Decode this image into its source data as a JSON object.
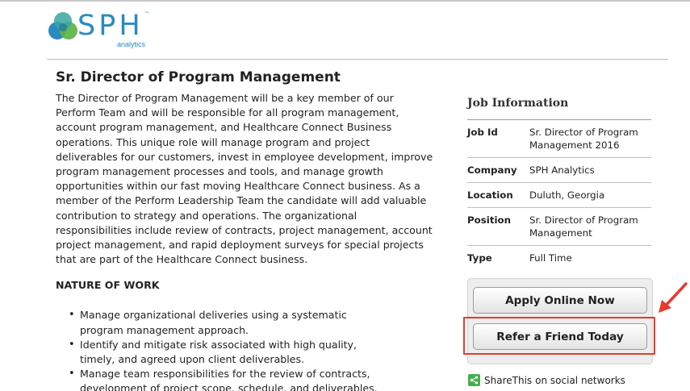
{
  "brand": {
    "name": "SPH",
    "trademark": "™",
    "tagline": "analytics",
    "colors": {
      "blue": "#2b8ac2",
      "green": "#5bb447",
      "teal": "#3aa6a0"
    }
  },
  "job": {
    "title": "Sr. Director of Program Management",
    "description": "The Director of Program Management will be a key member of our Perform Team and will be responsible for all program management, account program management, and Healthcare Connect Business operations.  This unique role will manage program and project deliverables for our customers, invest in employee development, improve program management processes and tools, and manage growth opportunities within our fast moving Healthcare Connect business. As a member of the Perform Leadership Team the candidate will add valuable contribution to strategy and operations. The organizational responsibilities include review of contracts, project management, account project management, and rapid deployment surveys for special projects that are part of the Healthcare Connect business.",
    "nature_heading": "NATURE OF WORK",
    "duties": [
      "Manage organizational deliveries using a systematic program management approach.",
      "Identify and mitigate risk associated with high quality, timely, and agreed upon client deliverables.",
      "Manage team responsibilities for the review of contracts, development of project scope, schedule, and deliverables."
    ]
  },
  "sidebar": {
    "heading": "Job Information",
    "rows": [
      {
        "label": "Job Id",
        "value": "Sr. Director of Program Management 2016"
      },
      {
        "label": "Company",
        "value": "SPH Analytics"
      },
      {
        "label": "Location",
        "value": "Duluth, Georgia"
      },
      {
        "label": "Position",
        "value": "Sr. Director of Program Management"
      },
      {
        "label": "Type",
        "value": "Full Time"
      }
    ],
    "apply_label": "Apply Online Now",
    "refer_label": "Refer a Friend Today",
    "share": {
      "brand": "ShareThis",
      "text": "on social networks",
      "icon": "share-icon",
      "icon_color": "#43b14b"
    },
    "highlight_color": "#e53b2c"
  }
}
